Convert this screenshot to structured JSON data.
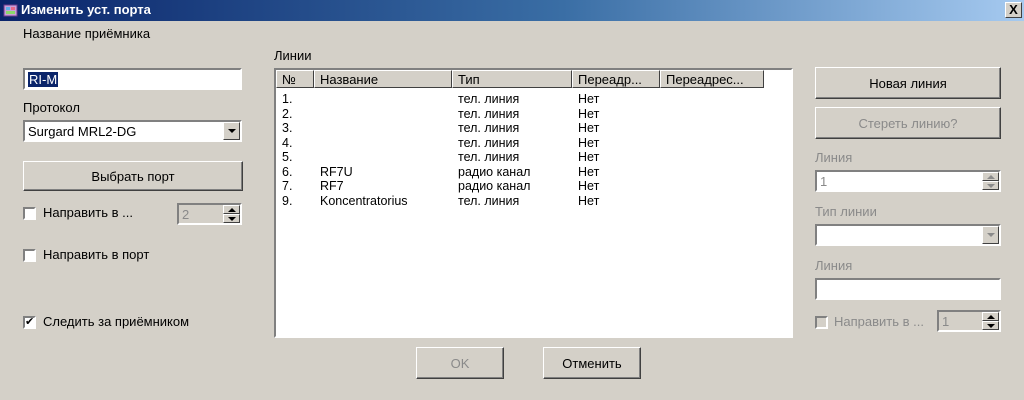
{
  "window": {
    "title": "Изменить уст. порта",
    "close_symbol": "X"
  },
  "left": {
    "receiver_name_label": "Название приёмника",
    "receiver_name_value": "RI-M",
    "protocol_label": "Протокол",
    "protocol_value": "Surgard MRL2-DG",
    "select_port_button": "Выбрать порт",
    "direct_to_label": "Направить в ...",
    "direct_to_value": "2",
    "direct_to_checked": false,
    "direct_to_port_label": "Направить в порт",
    "direct_to_port_checked": false,
    "watch_receiver_label": "Следить за приёмником",
    "watch_receiver_checked": true,
    "check_mark": "✔"
  },
  "lines": {
    "label": "Линии",
    "columns": [
      "№",
      "Название",
      "Тип",
      "Переадр...",
      "Переадрес..."
    ],
    "rows": [
      [
        "1.",
        "",
        "тел. линия",
        "Нет",
        ""
      ],
      [
        "2.",
        "",
        "тел. линия",
        "Нет",
        ""
      ],
      [
        "3.",
        "",
        "тел. линия",
        "Нет",
        ""
      ],
      [
        "4.",
        "",
        "тел. линия",
        "Нет",
        ""
      ],
      [
        "5.",
        "",
        "тел. линия",
        "Нет",
        ""
      ],
      [
        "6.",
        "RF7U",
        "радио канал",
        "Нет",
        ""
      ],
      [
        "7.",
        "RF7",
        "радио канал",
        "Нет",
        ""
      ],
      [
        "9.",
        "Koncentratorius",
        "тел. линия",
        "Нет",
        ""
      ]
    ]
  },
  "right": {
    "new_line_button": "Новая линия",
    "delete_line_button": "Стереть линию?",
    "line_label": "Линия",
    "line_value": "1",
    "line_type_label": "Тип линии",
    "line_type_value": "",
    "line2_label": "Линия",
    "line2_value": "",
    "direct_to_label": "Направить в ...",
    "direct_to_value": "1"
  },
  "buttons": {
    "ok": "OK",
    "cancel": "Отменить"
  },
  "colors": {
    "face": "#d4d0c8",
    "title_start": "#0a246a",
    "title_end": "#a6caf0",
    "disabled_text": "#8a8a8a"
  }
}
